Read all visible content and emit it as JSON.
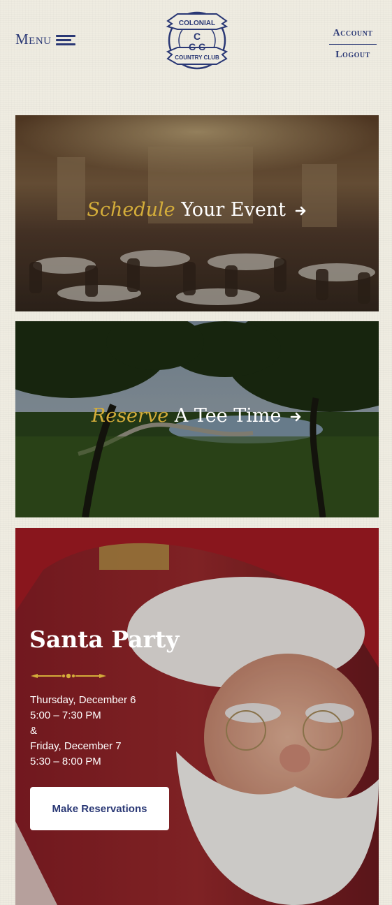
{
  "header": {
    "menu_label": "Menu",
    "logo_top_text": "COLONIAL",
    "logo_bottom_text": "COUNTRY CLUB",
    "logo_monogram": "CCC",
    "account_label": "Account",
    "logout_label": "Logout"
  },
  "cards": {
    "event": {
      "em": "Schedule",
      "rest": " Your Event"
    },
    "tee": {
      "em": "Reserve",
      "rest": " A Tee Time"
    },
    "santa": {
      "title": "Santa Party",
      "lines": [
        "Thursday, December 6",
        "5:00 – 7:30 PM",
        "&",
        "Friday, December 7",
        "5:30 – 8:00 PM"
      ],
      "button_label": "Make Reservations"
    }
  },
  "colors": {
    "brand_navy": "#2a3875",
    "accent_gold": "#d4ad3a",
    "background": "#efece1"
  }
}
